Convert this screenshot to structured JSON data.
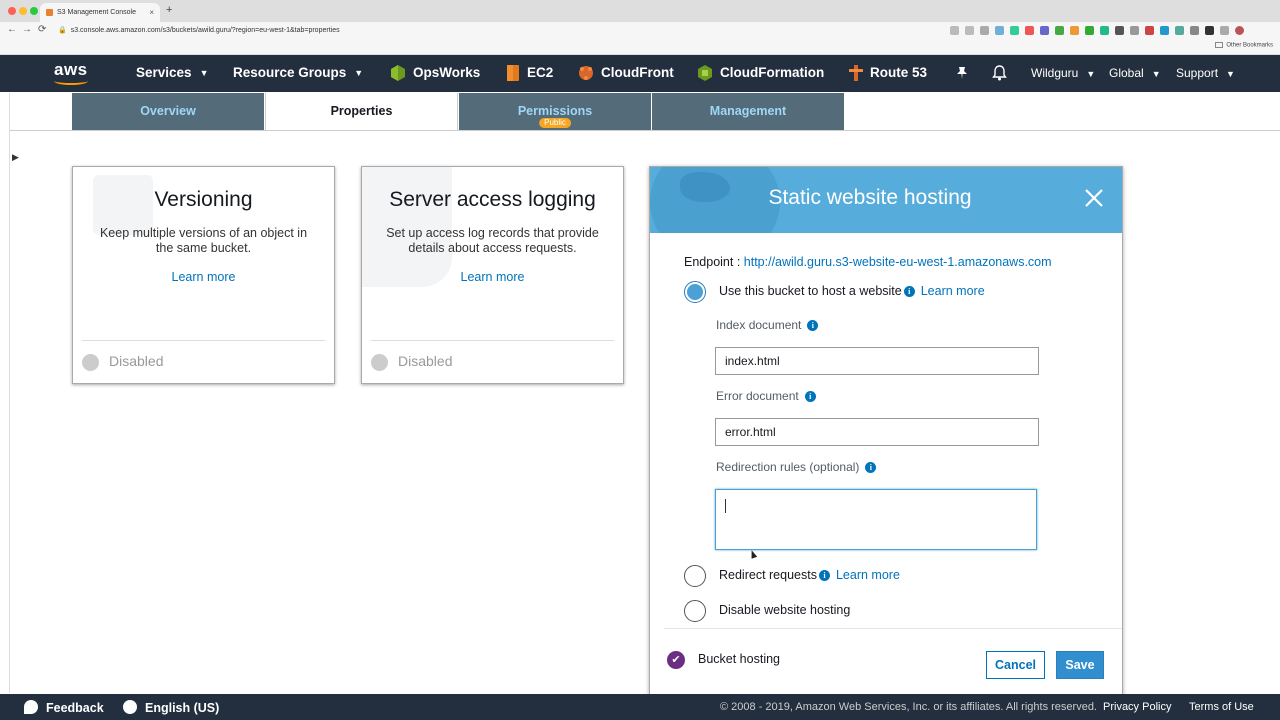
{
  "browser": {
    "tab_title": "S3 Management Console",
    "tab_close": "×",
    "new_tab": "+",
    "back": "←",
    "forward": "→",
    "reload": "⟳",
    "url": "s3.console.aws.amazon.com/s3/buckets/awild.guru/?region=eu-west-1&tab=properties",
    "other_bookmarks": "Other Bookmarks"
  },
  "aws_nav": {
    "logo": "aws",
    "services": "Services",
    "resource_groups": "Resource Groups",
    "pinned": [
      "OpsWorks",
      "EC2",
      "CloudFront",
      "CloudFormation",
      "Route 53"
    ],
    "account": "Wildguru",
    "region": "Global",
    "support": "Support"
  },
  "tabs": [
    {
      "label": "Overview"
    },
    {
      "label": "Properties"
    },
    {
      "label": "Permissions",
      "badge": "Public"
    },
    {
      "label": "Management"
    }
  ],
  "cards": [
    {
      "title": "Versioning",
      "description": "Keep multiple versions of an object in the same bucket.",
      "learn_more": "Learn more",
      "status": "Disabled"
    },
    {
      "title": "Server access logging",
      "description": "Set up access log records that provide details about access requests.",
      "learn_more": "Learn more",
      "status": "Disabled"
    }
  ],
  "hosting": {
    "title": "Static website hosting",
    "endpoint_label": "Endpoint :",
    "endpoint_url": "http://awild.guru.s3-website-eu-west-1.amazonaws.com",
    "option_host": "Use this bucket to host a website",
    "option_redirect": "Redirect requests",
    "option_disable": "Disable website hosting",
    "learn_more": "Learn more",
    "index_label": "Index document",
    "index_value": "index.html",
    "error_label": "Error document",
    "error_value": "error.html",
    "redirection_label": "Redirection rules (optional)",
    "bucket_hosting": "Bucket hosting",
    "cancel": "Cancel",
    "save": "Save",
    "info": "i",
    "selected_option": "host"
  },
  "footer": {
    "feedback": "Feedback",
    "language": "English (US)",
    "copyright": "© 2008 - 2019, Amazon Web Services, Inc. or its affiliates. All rights reserved.",
    "privacy": "Privacy Policy",
    "terms": "Terms of Use"
  },
  "colors": {
    "nav_bg": "#232f3e",
    "panel_header": "#56addc",
    "link": "#0073bb",
    "tab_bg": "#546b7a",
    "badge": "#f5a623"
  }
}
